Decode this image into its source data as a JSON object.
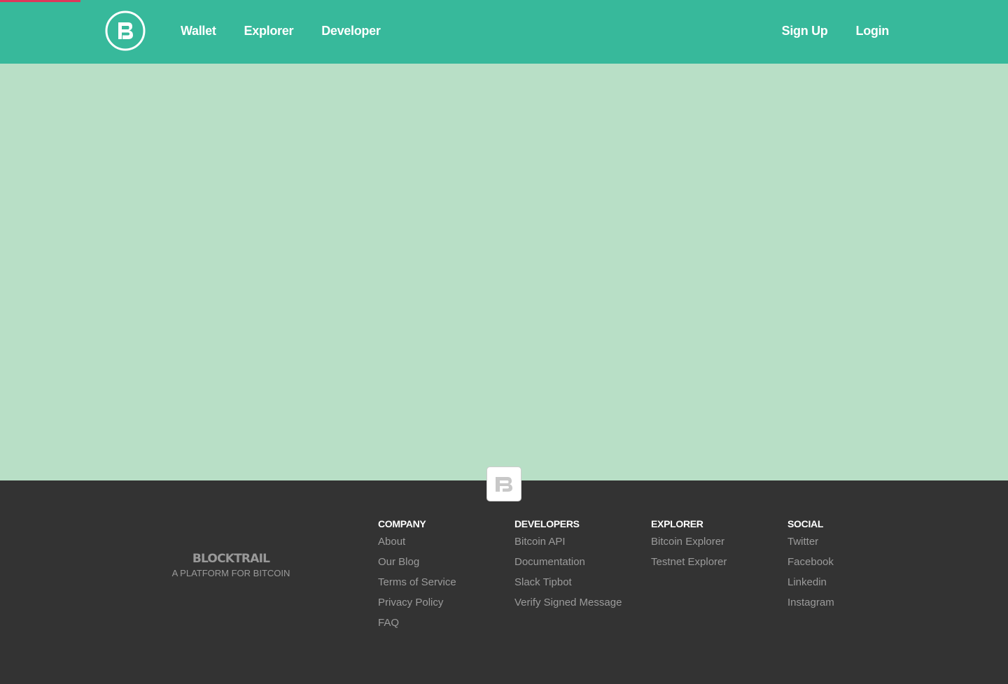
{
  "header": {
    "logo_icon": "blocktrail-b-logo-icon",
    "nav_left": [
      {
        "label": "Wallet"
      },
      {
        "label": "Explorer"
      },
      {
        "label": "Developer"
      }
    ],
    "nav_right": [
      {
        "label": "Sign Up"
      },
      {
        "label": "Login"
      }
    ]
  },
  "footer": {
    "badge_icon": "blocktrail-b-logo-icon",
    "brand": {
      "name": "BLOCKTRAIL",
      "tagline": "A PLATFORM FOR BITCOIN"
    },
    "columns": [
      {
        "heading": "COMPANY",
        "links": [
          "About",
          "Our Blog",
          "Terms of Service",
          "Privacy Policy",
          "FAQ"
        ]
      },
      {
        "heading": "DEVELOPERS",
        "links": [
          "Bitcoin API",
          "Documentation",
          "Slack Tipbot",
          "Verify Signed Message"
        ]
      },
      {
        "heading": "EXPLORER",
        "links": [
          "Bitcoin Explorer",
          "Testnet Explorer"
        ]
      },
      {
        "heading": "SOCIAL",
        "links": [
          "Twitter",
          "Facebook",
          "Linkedin",
          "Instagram"
        ]
      }
    ]
  },
  "colors": {
    "header": "#37b99b",
    "content": "#b8dfc6",
    "footer": "#333333",
    "progress": "#e0375b"
  }
}
